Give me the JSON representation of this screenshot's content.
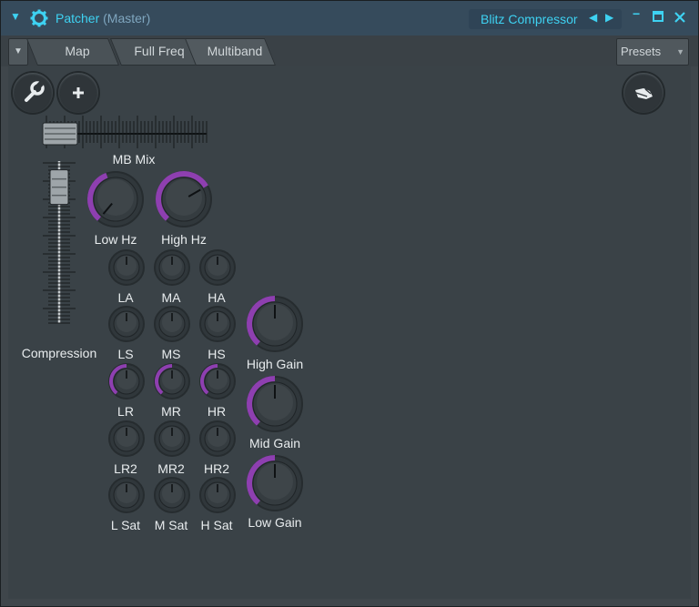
{
  "titlebar": {
    "window_title": "Patcher",
    "window_subtitle": "(Master)",
    "plugin_name": "Blitz Compressor",
    "prev_arrow": "◀",
    "next_arrow": "▶",
    "minimize": "−",
    "maximize": "□",
    "close": "✕",
    "menu_arrow": "▼"
  },
  "toolbar": {
    "dropdown_arrow": "▼",
    "tabs": [
      {
        "label": "Map"
      },
      {
        "label": "Full Freq"
      },
      {
        "label": "Multiband"
      }
    ],
    "active_tab": "Multiband",
    "presets_label": "Presets",
    "presets_arrow": "▼"
  },
  "buttons": {
    "wrench": "wrench-icon",
    "add": "plus-icon",
    "hand": "hand-icon"
  },
  "sliders": {
    "mb_mix": {
      "label": "MB Mix",
      "value": 0.0
    },
    "compression": {
      "label": "Compression",
      "value": 0.92
    }
  },
  "knobs": {
    "low_hz": {
      "label": "Low Hz",
      "value": 0.25
    },
    "high_hz": {
      "label": "High Hz",
      "value": 0.62
    },
    "la": {
      "label": "LA",
      "value": 0.5
    },
    "ma": {
      "label": "MA",
      "value": 0.5
    },
    "ha": {
      "label": "HA",
      "value": 0.5
    },
    "ls": {
      "label": "LS",
      "value": 0.5
    },
    "ms": {
      "label": "MS",
      "value": 0.5
    },
    "hs": {
      "label": "HS",
      "value": 0.5
    },
    "lr": {
      "label": "LR",
      "value": 0.5
    },
    "mr": {
      "label": "MR",
      "value": 0.5
    },
    "hr": {
      "label": "HR",
      "value": 0.5
    },
    "lr2": {
      "label": "LR2",
      "value": 0.5
    },
    "mr2": {
      "label": "MR2",
      "value": 0.5
    },
    "hr2": {
      "label": "HR2",
      "value": 0.5
    },
    "l_sat": {
      "label": "L Sat",
      "value": 0.5
    },
    "m_sat": {
      "label": "M Sat",
      "value": 0.5
    },
    "h_sat": {
      "label": "H Sat",
      "value": 0.5
    },
    "high_gain": {
      "label": "High Gain",
      "value": 0.5
    },
    "mid_gain": {
      "label": "Mid Gain",
      "value": 0.5
    },
    "low_gain": {
      "label": "Low Gain",
      "value": 0.5
    }
  },
  "colors": {
    "accent": "#3ed2f2",
    "knob_arc": "#8e3fb0",
    "knob_body": "#2f3539"
  }
}
